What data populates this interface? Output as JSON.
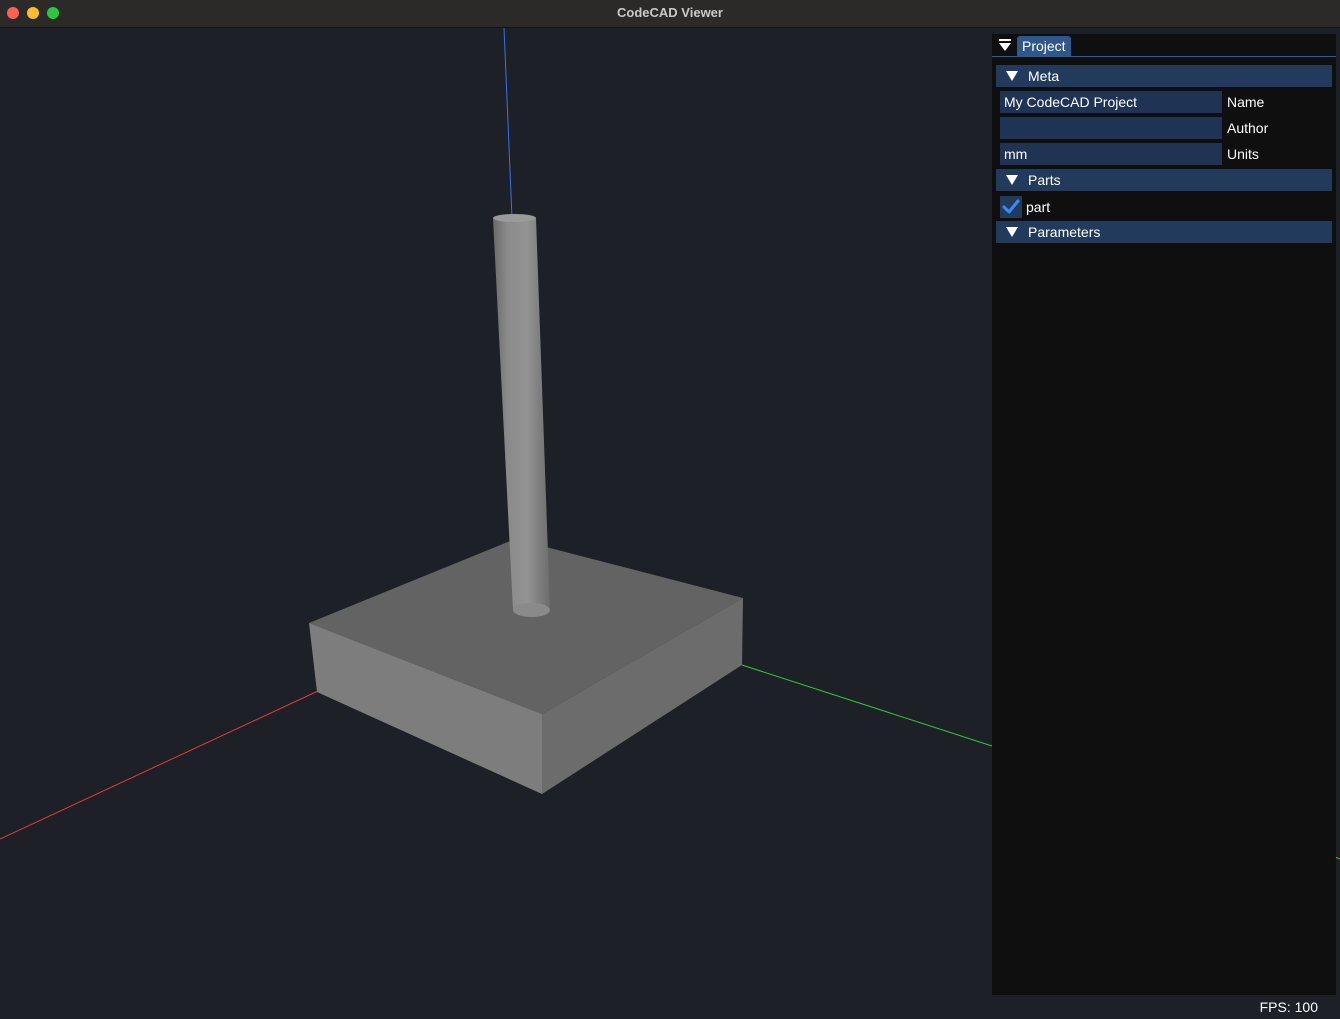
{
  "window": {
    "title": "CodeCAD Viewer"
  },
  "panel": {
    "tab_label": "Project",
    "sections": {
      "meta": {
        "label": "Meta",
        "fields": {
          "name": {
            "value": "My CodeCAD Project",
            "label": "Name"
          },
          "author": {
            "value": "",
            "label": "Author"
          },
          "units": {
            "value": "mm",
            "label": "Units"
          }
        }
      },
      "parts": {
        "label": "Parts",
        "items": [
          {
            "label": "part",
            "checked": true
          }
        ]
      },
      "parameters": {
        "label": "Parameters"
      }
    }
  },
  "status": {
    "fps_text": "FPS: 100"
  },
  "colors": {
    "background": "#1d2026",
    "x_axis": "#e23b3b",
    "y_axis": "#33c933",
    "z_axis": "#3e6ee6",
    "accent": "#2f5789",
    "section_header": "#223a5c"
  },
  "icons": {
    "close": "close-window-icon",
    "minimize": "minimize-window-icon",
    "maximize": "maximize-window-icon",
    "panel_menu": "panel-menu-icon",
    "section_toggle": "collapse-triangle-icon",
    "checkbox": "checkmark-icon"
  }
}
